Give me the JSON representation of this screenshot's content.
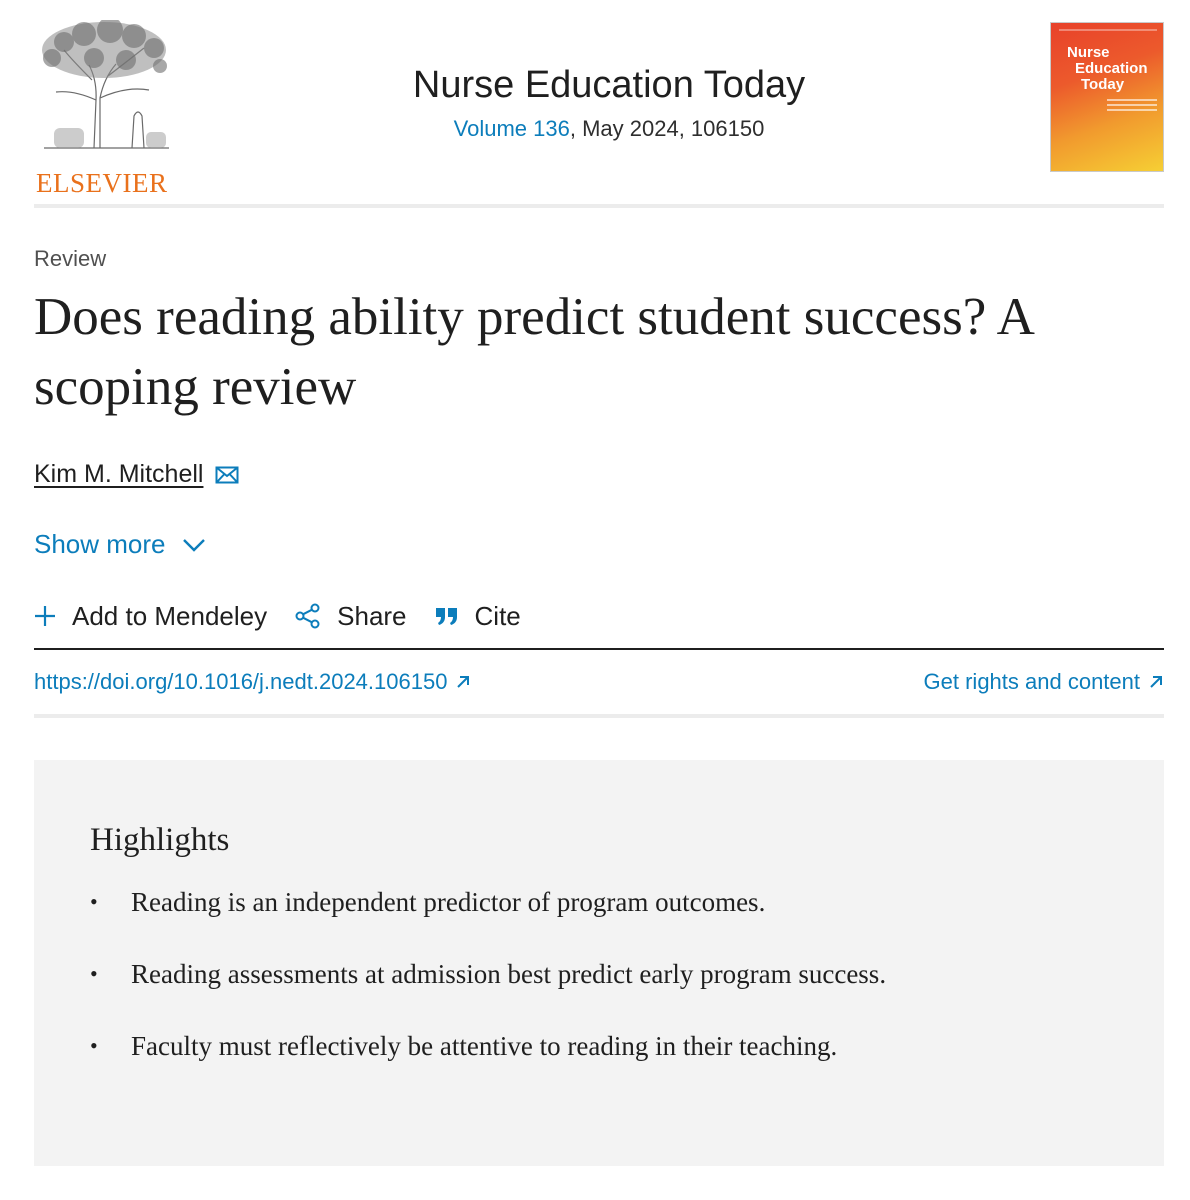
{
  "header": {
    "publisher": "ELSEVIER",
    "journal_title": "Nurse Education Today",
    "volume_link": "Volume 136",
    "issue_rest": ", May 2024, 106150",
    "cover": {
      "line1": "Nurse",
      "line2": "Education",
      "line3": "Today"
    }
  },
  "article": {
    "type": "Review",
    "title": "Does reading ability predict student success? A scoping review",
    "author": "Kim M. Mitchell",
    "show_more": "Show more"
  },
  "toolbar": {
    "add_mendeley": "Add to Mendeley",
    "share": "Share",
    "cite": "Cite"
  },
  "links": {
    "doi": "https://doi.org/10.1016/j.nedt.2024.106150",
    "rights": "Get rights and content"
  },
  "highlights": {
    "heading": "Highlights",
    "bullet": "•",
    "items": [
      "Reading is an independent predictor of program outcomes.",
      "Reading assessments at admission best predict early program success.",
      "Faculty must reflectively be attentive to reading in their teaching."
    ]
  },
  "colors": {
    "link": "#0c7dbb",
    "publisher_orange": "#e9711c",
    "highlights_bg": "#f3f3f3"
  },
  "icons": [
    "elsevier-tree-logo",
    "mail-icon",
    "chevron-down-icon",
    "plus-icon",
    "share-icon",
    "quote-icon",
    "external-arrow-icon"
  ]
}
